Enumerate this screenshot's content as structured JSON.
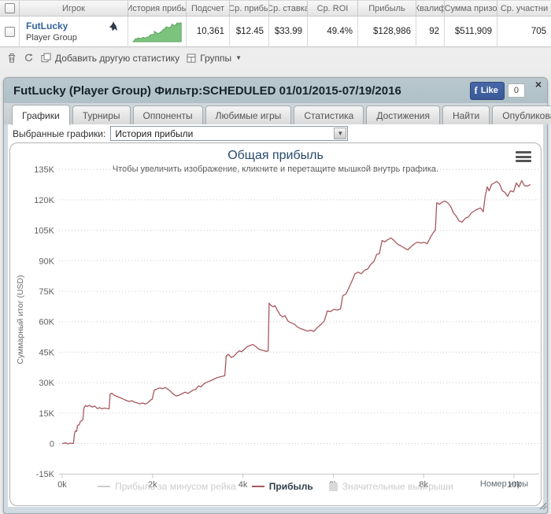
{
  "colors": {
    "line": "#a8585e",
    "spark_fill": "#7cc47e",
    "spark_stroke": "#61a563",
    "player_link": "#33659c",
    "fb_blue": "#3b5998",
    "chart_title": "#274b6d"
  },
  "glyphs": {
    "caret_down": "▼",
    "close": "×"
  },
  "table": {
    "columns": [
      {
        "label": "Игрок"
      },
      {
        "label": "История прибы"
      },
      {
        "label": "Подсчет"
      },
      {
        "label": "Ср. прибы"
      },
      {
        "label": "Ср. ставка"
      },
      {
        "label": "Ср. ROI"
      },
      {
        "label": "Прибыль"
      },
      {
        "label": "Квалиф"
      },
      {
        "label": "Сумма призо"
      },
      {
        "label": "Ср. участни"
      }
    ],
    "row": {
      "player_name": "FutLucky",
      "player_type": "Player Group",
      "count": "10,361",
      "avg_profit": "$12.45",
      "avg_stake": "$33.99",
      "avg_roi": "49.4%",
      "profit": "$128,986",
      "qualified": "92",
      "prize_total": "$511,909",
      "avg_entrants": "705"
    },
    "toolbar": {
      "add_label": "Добавить другую статистику",
      "groups_label": "Группы"
    }
  },
  "panel": {
    "title": "FutLucky (Player Group) Фильтр:SCHEDULED 01/01/2015-07/19/2016",
    "like_label": "Like",
    "like_count": "0",
    "tabs": [
      {
        "label": "Графики",
        "active": true
      },
      {
        "label": "Турниры",
        "active": false
      },
      {
        "label": "Оппоненты",
        "active": false
      },
      {
        "label": "Любимые игры",
        "active": false
      },
      {
        "label": "Статистика",
        "active": false
      },
      {
        "label": "Достижения",
        "active": false
      },
      {
        "label": "Найти",
        "active": false
      },
      {
        "label": "Опубликовать",
        "active": false
      }
    ],
    "selected_charts_label": "Выбранные графики:",
    "chart_select_value": "История прибыли"
  },
  "chart_data": {
    "type": "line",
    "title": "Общая прибыль",
    "subtitle": "Чтобы увеличить изображение, кликните и перетащите мышкой внутрь графика.",
    "xlabel": "Номер игры",
    "ylabel": "Суммарный итог (USD)",
    "grid": "dotted horizontal",
    "legend_position": "bottom",
    "ylim_k": [
      -15,
      135
    ],
    "xlim_k": [
      0,
      10.55
    ],
    "yticks": [
      {
        "v": 135,
        "label": "135K"
      },
      {
        "v": 120,
        "label": "120K"
      },
      {
        "v": 105,
        "label": "105K"
      },
      {
        "v": 90,
        "label": "90K"
      },
      {
        "v": 75,
        "label": "75K"
      },
      {
        "v": 60,
        "label": "60K"
      },
      {
        "v": 45,
        "label": "45K"
      },
      {
        "v": 30,
        "label": "30K"
      },
      {
        "v": 15,
        "label": "15K"
      },
      {
        "v": 0,
        "label": "0"
      },
      {
        "v": -15,
        "label": "-15K"
      }
    ],
    "xticks": [
      {
        "v": 0,
        "label": "0k"
      },
      {
        "v": 2,
        "label": "2k"
      },
      {
        "v": 4,
        "label": "4k"
      },
      {
        "v": 6,
        "label": "6k"
      },
      {
        "v": 8,
        "label": "8k"
      },
      {
        "v": 10,
        "label": "10k"
      }
    ],
    "units": "x = game number in thousands, y = cumulative profit in $K",
    "series": [
      {
        "name": "Прибыль за минусом рейка",
        "color": "#cccccc",
        "visible": false,
        "swatch": "line"
      },
      {
        "name": "Прибыль",
        "color": "#a8585e",
        "visible": true,
        "swatch": "line",
        "points": [
          [
            0.0,
            0
          ],
          [
            0.08,
            0.3
          ],
          [
            0.13,
            -0.2
          ],
          [
            0.18,
            0.2
          ],
          [
            0.25,
            0
          ],
          [
            0.27,
            4.5
          ],
          [
            0.29,
            6.2
          ],
          [
            0.32,
            6.0
          ],
          [
            0.34,
            8.9
          ],
          [
            0.38,
            9.3
          ],
          [
            0.4,
            10.9
          ],
          [
            0.44,
            11.4
          ],
          [
            0.46,
            12.1
          ],
          [
            0.48,
            17.6
          ],
          [
            0.52,
            18.8
          ],
          [
            0.55,
            18.2
          ],
          [
            0.6,
            18.8
          ],
          [
            0.63,
            18.3
          ],
          [
            0.67,
            18.0
          ],
          [
            0.72,
            18.5
          ],
          [
            0.78,
            17.2
          ],
          [
            0.83,
            17.7
          ],
          [
            0.88,
            17.1
          ],
          [
            0.93,
            17.5
          ],
          [
            1.0,
            17.2
          ],
          [
            1.04,
            17.1
          ],
          [
            1.06,
            24.3
          ],
          [
            1.1,
            24.8
          ],
          [
            1.14,
            23.9
          ],
          [
            1.2,
            23.3
          ],
          [
            1.27,
            22.7
          ],
          [
            1.34,
            22.0
          ],
          [
            1.41,
            21.3
          ],
          [
            1.48,
            20.7
          ],
          [
            1.54,
            21.1
          ],
          [
            1.6,
            20.4
          ],
          [
            1.66,
            20.0
          ],
          [
            1.72,
            19.5
          ],
          [
            1.78,
            20.0
          ],
          [
            1.84,
            19.4
          ],
          [
            1.9,
            20.2
          ],
          [
            1.95,
            21.3
          ],
          [
            1.99,
            21.8
          ],
          [
            2.04,
            26.3
          ],
          [
            2.1,
            26.9
          ],
          [
            2.16,
            27.4
          ],
          [
            2.22,
            27.0
          ],
          [
            2.28,
            27.6
          ],
          [
            2.34,
            26.8
          ],
          [
            2.4,
            25.7
          ],
          [
            2.47,
            24.1
          ],
          [
            2.53,
            23.4
          ],
          [
            2.6,
            23.9
          ],
          [
            2.66,
            24.6
          ],
          [
            2.72,
            25.3
          ],
          [
            2.78,
            24.7
          ],
          [
            2.84,
            25.5
          ],
          [
            2.9,
            26.3
          ],
          [
            2.96,
            26.8
          ],
          [
            3.02,
            28.4
          ],
          [
            3.07,
            27.9
          ],
          [
            3.13,
            29.3
          ],
          [
            3.19,
            30.1
          ],
          [
            3.26,
            30.7
          ],
          [
            3.33,
            31.4
          ],
          [
            3.4,
            32.2
          ],
          [
            3.47,
            32.7
          ],
          [
            3.54,
            33.1
          ],
          [
            3.6,
            33.4
          ],
          [
            3.63,
            43.1
          ],
          [
            3.68,
            43.9
          ],
          [
            3.74,
            42.4
          ],
          [
            3.8,
            43.0
          ],
          [
            3.86,
            44.5
          ],
          [
            3.92,
            45.7
          ],
          [
            3.97,
            45.2
          ],
          [
            4.03,
            46.3
          ],
          [
            4.09,
            47.7
          ],
          [
            4.15,
            48.2
          ],
          [
            4.22,
            48.8
          ],
          [
            4.29,
            47.7
          ],
          [
            4.36,
            46.3
          ],
          [
            4.44,
            45.9
          ],
          [
            4.52,
            45.4
          ],
          [
            4.56,
            45.6
          ],
          [
            4.58,
            69.1
          ],
          [
            4.62,
            68.1
          ],
          [
            4.67,
            67.3
          ],
          [
            4.71,
            67.9
          ],
          [
            4.76,
            65.8
          ],
          [
            4.82,
            63.4
          ],
          [
            4.88,
            62.3
          ],
          [
            4.93,
            63.0
          ],
          [
            5.0,
            60.2
          ],
          [
            5.07,
            59.4
          ],
          [
            5.14,
            58.8
          ],
          [
            5.21,
            57.3
          ],
          [
            5.28,
            56.6
          ],
          [
            5.35,
            56.0
          ],
          [
            5.43,
            55.4
          ],
          [
            5.5,
            55.8
          ],
          [
            5.57,
            55.2
          ],
          [
            5.64,
            56.9
          ],
          [
            5.72,
            58.5
          ],
          [
            5.8,
            60.3
          ],
          [
            5.87,
            65.3
          ],
          [
            5.94,
            65.0
          ],
          [
            6.01,
            66.1
          ],
          [
            6.09,
            65.7
          ],
          [
            6.16,
            66.3
          ],
          [
            6.21,
            72.8
          ],
          [
            6.28,
            73.6
          ],
          [
            6.35,
            76.9
          ],
          [
            6.42,
            80.4
          ],
          [
            6.48,
            83.6
          ],
          [
            6.55,
            84.4
          ],
          [
            6.62,
            83.6
          ],
          [
            6.69,
            85.3
          ],
          [
            6.76,
            85.9
          ],
          [
            6.83,
            88.2
          ],
          [
            6.9,
            89.7
          ],
          [
            6.96,
            93.1
          ],
          [
            7.02,
            93.5
          ],
          [
            7.08,
            100.0
          ],
          [
            7.14,
            99.3
          ],
          [
            7.21,
            100.5
          ],
          [
            7.28,
            101.2
          ],
          [
            7.35,
            99.9
          ],
          [
            7.42,
            98.2
          ],
          [
            7.5,
            97.3
          ],
          [
            7.58,
            96.2
          ],
          [
            7.65,
            95.4
          ],
          [
            7.72,
            96.9
          ],
          [
            7.8,
            98.4
          ],
          [
            7.87,
            99.2
          ],
          [
            7.94,
            98.7
          ],
          [
            8.01,
            99.1
          ],
          [
            8.08,
            98.4
          ],
          [
            8.15,
            101.5
          ],
          [
            8.21,
            103.8
          ],
          [
            8.26,
            105.1
          ],
          [
            8.29,
            118.6
          ],
          [
            8.35,
            117.8
          ],
          [
            8.41,
            118.9
          ],
          [
            8.47,
            119.4
          ],
          [
            8.53,
            118.6
          ],
          [
            8.6,
            116.7
          ],
          [
            8.66,
            113.6
          ],
          [
            8.72,
            112.0
          ],
          [
            8.78,
            109.7
          ],
          [
            8.85,
            109.0
          ],
          [
            8.92,
            110.9
          ],
          [
            8.99,
            111.6
          ],
          [
            9.06,
            113.6
          ],
          [
            9.13,
            114.7
          ],
          [
            9.2,
            115.5
          ],
          [
            9.26,
            116.0
          ],
          [
            9.32,
            114.1
          ],
          [
            9.36,
            121.7
          ],
          [
            9.41,
            126.4
          ],
          [
            9.45,
            124.4
          ],
          [
            9.5,
            127.5
          ],
          [
            9.56,
            128.3
          ],
          [
            9.62,
            129.1
          ],
          [
            9.68,
            127.8
          ],
          [
            9.74,
            124.5
          ],
          [
            9.8,
            123.7
          ],
          [
            9.86,
            121.7
          ],
          [
            9.92,
            124.4
          ],
          [
            9.99,
            123.9
          ],
          [
            10.05,
            128.3
          ],
          [
            10.11,
            126.4
          ],
          [
            10.17,
            129.5
          ],
          [
            10.23,
            127.0
          ],
          [
            10.3,
            126.8
          ],
          [
            10.36,
            127.6
          ]
        ]
      },
      {
        "name": "Значительные выигрыши",
        "color": "#d9d9d9",
        "visible": false,
        "swatch": "square"
      }
    ]
  }
}
